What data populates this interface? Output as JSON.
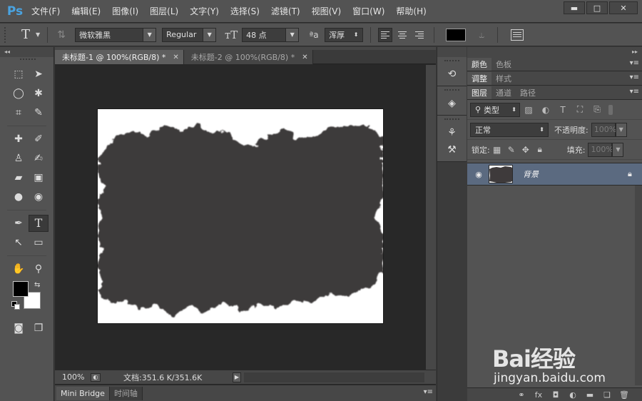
{
  "app": {
    "logo": "Ps"
  },
  "menu": [
    "文件(F)",
    "编辑(E)",
    "图像(I)",
    "图层(L)",
    "文字(Y)",
    "选择(S)",
    "滤镜(T)",
    "视图(V)",
    "窗口(W)",
    "帮助(H)"
  ],
  "window_controls": {
    "minimize": "▬",
    "restore": "□",
    "close": "✕"
  },
  "options": {
    "tool_glyph": "T",
    "font_family": "微软雅黑",
    "font_style": "Regular",
    "font_size": "48 点",
    "antialias": "浑厚",
    "color": "#000000"
  },
  "tabs": [
    {
      "label": "未标题-1 @ 100%(RGB/8) *",
      "active": true
    },
    {
      "label": "未标题-2 @ 100%(RGB/8) *",
      "active": false
    }
  ],
  "status": {
    "zoom": "100%",
    "doc_info": "文档:351.6 K/351.6K"
  },
  "bottom_tabs": [
    "Mini Bridge",
    "时间轴"
  ],
  "panels": {
    "top_tabs": [
      "颜色",
      "色板"
    ],
    "mid_tabs": [
      "调整",
      "样式"
    ],
    "layer_tabs": [
      "图层",
      "通道",
      "路径"
    ],
    "filter_label": "类型",
    "blend_mode": "正常",
    "opacity_label": "不透明度:",
    "opacity_value": "100%",
    "lock_label": "锁定:",
    "fill_label": "填充:",
    "fill_value": "100%",
    "layer_name": "背景"
  },
  "watermark": {
    "brand": "Bai经验",
    "url": "jingyan.baidu.com"
  }
}
